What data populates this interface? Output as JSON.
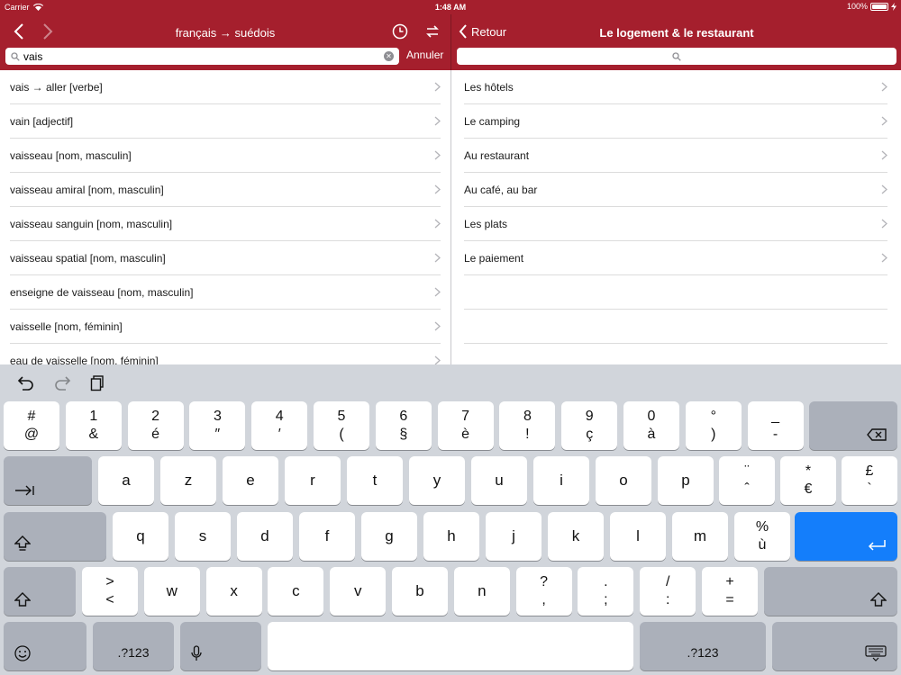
{
  "status": {
    "carrier": "Carrier",
    "time": "1:48 AM",
    "battery": "100%"
  },
  "left_header": {
    "title": "français → suédois",
    "search_value": "vais",
    "cancel_label": "Annuler",
    "icons": {
      "back": "chevron-left-icon",
      "forward": "chevron-right-icon",
      "history": "clock-icon",
      "swap": "swap-icon"
    }
  },
  "right_header": {
    "back_label": "Retour",
    "title": "Le logement & le restaurant",
    "search_placeholder": ""
  },
  "left_list": [
    "vais → aller [verbe]",
    "vain [adjectif]",
    "vaisseau [nom, masculin]",
    "vaisseau amiral [nom, masculin]",
    "vaisseau sanguin [nom, masculin]",
    "vaisseau spatial [nom, masculin]",
    "enseigne de vaisseau [nom, masculin]",
    "vaisselle [nom, féminin]",
    "eau de vaisselle [nom, féminin]"
  ],
  "right_list": [
    "Les hôtels",
    "Le camping",
    "Au restaurant",
    "Au café, au bar",
    "Les plats",
    "Le paiement"
  ],
  "keyboard": {
    "row1": [
      [
        "#",
        "@"
      ],
      [
        "1",
        "&"
      ],
      [
        "2",
        "é"
      ],
      [
        "3",
        "″"
      ],
      [
        "4",
        "′"
      ],
      [
        "5",
        "("
      ],
      [
        "6",
        "§"
      ],
      [
        "7",
        "è"
      ],
      [
        "8",
        "!"
      ],
      [
        "9",
        "ç"
      ],
      [
        "0",
        "à"
      ],
      [
        "°",
        ")"
      ],
      [
        "_",
        "-"
      ]
    ],
    "row2": [
      "a",
      "z",
      "e",
      "r",
      "t",
      "y",
      "u",
      "i",
      "o",
      "p"
    ],
    "row2_extra": [
      [
        "¨",
        "ˆ"
      ],
      [
        "*",
        "€"
      ],
      [
        "£",
        "`"
      ]
    ],
    "row3": [
      "q",
      "s",
      "d",
      "f",
      "g",
      "h",
      "j",
      "k",
      "l",
      "m"
    ],
    "row3_extra": [
      [
        "%",
        "ù"
      ]
    ],
    "row4": [
      [
        ">",
        "<"
      ],
      [
        "w"
      ],
      [
        "x"
      ],
      [
        "c"
      ],
      [
        "v"
      ],
      [
        "b"
      ],
      [
        "n"
      ],
      [
        "?",
        ","
      ],
      [
        ".",
        ";"
      ],
      [
        "/",
        ":"
      ],
      [
        "+",
        "="
      ]
    ],
    "numbers_label": ".?123"
  }
}
